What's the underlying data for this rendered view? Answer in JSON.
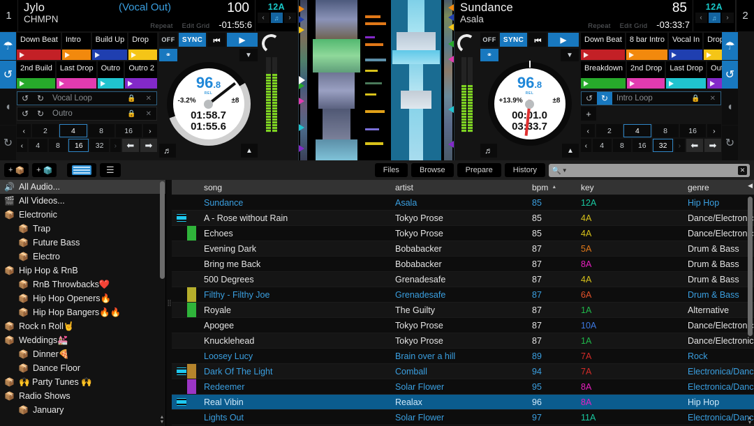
{
  "decks": {
    "left": {
      "number": "1",
      "title": "Jylo",
      "artist": "CHMPN",
      "status": "(Vocal Out)",
      "bpm": "100",
      "time_remaining": "-01:55:6",
      "repeat_label": "Repeat",
      "edit_grid_label": "Edit Grid",
      "key": "12A",
      "platter": {
        "bpm_int": "96",
        "bpm_dec": ".8",
        "rel_label": "REL",
        "pitch": "-3.2%",
        "range": "±8",
        "time_elapsed": "01:58.7",
        "time_total": "01:55.6"
      },
      "transport": {
        "off": "OFF",
        "sync": "SYNC",
        "cue": "⏮",
        "play": "▶"
      },
      "cues": [
        {
          "label": "Down Beat",
          "color": "#c32026"
        },
        {
          "label": "Intro",
          "color": "#f2890d"
        },
        {
          "label": "Build Up",
          "color": "#1f3fb0"
        },
        {
          "label": "Drop",
          "color": "#f5c517"
        },
        {
          "label": "2nd Build",
          "color": "#27a92b"
        },
        {
          "label": "Last Drop",
          "color": "#e23bb0"
        },
        {
          "label": "Outro",
          "color": "#20c4cf"
        },
        {
          "label": "Outro 2",
          "color": "#8329c9"
        }
      ],
      "loops": [
        {
          "name": "Vocal Loop",
          "active": false
        },
        {
          "name": "Outro",
          "active": false
        }
      ],
      "beat_row_1": [
        "‹",
        "2",
        "4",
        "8",
        "16",
        "›"
      ],
      "beat_row_1_selected": "4",
      "beat_row_2": [
        "‹",
        "4",
        "8",
        "16",
        "32",
        "›"
      ],
      "beat_row_2_selected": "16",
      "shift_left": "⬅",
      "shift_right": "➡"
    },
    "right": {
      "number": "2",
      "title": "Sundance",
      "artist": "Asala",
      "status": "",
      "bpm": "85",
      "time_remaining": "-03:33:7",
      "repeat_label": "Repeat",
      "edit_grid_label": "Edit Grid",
      "key": "12A",
      "platter": {
        "bpm_int": "96",
        "bpm_dec": ".8",
        "rel_label": "REL",
        "pitch": "+13.9%",
        "range": "±8",
        "time_elapsed": "00:01.0",
        "time_total": "03:33.7"
      },
      "transport": {
        "off": "OFF",
        "sync": "SYNC",
        "cue": "⏮",
        "play": "▶"
      },
      "cues": [
        {
          "label": "Down Beat",
          "color": "#c32026"
        },
        {
          "label": "8 bar Intro",
          "color": "#f2890d"
        },
        {
          "label": "Vocal In",
          "color": "#1f3fb0"
        },
        {
          "label": "Drop",
          "color": "#f5c517"
        },
        {
          "label": "Breakdown",
          "color": "#27a92b"
        },
        {
          "label": "2nd Drop",
          "color": "#e23bb0"
        },
        {
          "label": "Last Drop",
          "color": "#20c4cf"
        },
        {
          "label": "Outro",
          "color": "#8329c9"
        }
      ],
      "loops": [
        {
          "name": "Intro Loop",
          "active": true
        }
      ],
      "add_loop_label": "+",
      "beat_row_1": [
        "‹",
        "2",
        "4",
        "8",
        "16",
        "›"
      ],
      "beat_row_1_selected": "4",
      "beat_row_2": [
        "‹",
        "4",
        "8",
        "16",
        "32",
        "›"
      ],
      "beat_row_2_selected": "32",
      "shift_left": "⬅",
      "shift_right": "➡"
    }
  },
  "toolbar": {
    "add_crate_label": "+",
    "add_smart_crate_label": "+",
    "tabs": [
      "Files",
      "Browse",
      "Prepare",
      "History"
    ],
    "search_placeholder": "",
    "search_value": "",
    "clear_label": "✕"
  },
  "sidebar": {
    "items": [
      {
        "label": "All Audio...",
        "icon": "speaker-icon",
        "level": 0,
        "selected": true
      },
      {
        "label": "All Videos...",
        "icon": "film-icon",
        "level": 0,
        "selected": false
      },
      {
        "label": "Electronic",
        "icon": "crate-icon",
        "level": 0,
        "selected": false
      },
      {
        "label": "Trap",
        "icon": "crate-icon",
        "level": 1,
        "selected": false
      },
      {
        "label": "Future Bass",
        "icon": "crate-icon",
        "level": 1,
        "selected": false
      },
      {
        "label": "Electro",
        "icon": "crate-icon",
        "level": 1,
        "selected": false
      },
      {
        "label": "Hip Hop & RnB",
        "icon": "crate-icon",
        "level": 0,
        "selected": false
      },
      {
        "label": "RnB Throwbacks❤️",
        "icon": "crate-icon",
        "level": 1,
        "selected": false
      },
      {
        "label": "Hip Hop Openers🔥",
        "icon": "crate-icon",
        "level": 1,
        "selected": false
      },
      {
        "label": "Hip Hop Bangers🔥🔥",
        "icon": "crate-icon",
        "level": 1,
        "selected": false
      },
      {
        "label": "Rock n Roll🤘",
        "icon": "crate-icon",
        "level": 0,
        "selected": false
      },
      {
        "label": "Weddings💒",
        "icon": "crate-icon",
        "level": 0,
        "selected": false
      },
      {
        "label": "Dinner🍕",
        "icon": "crate-icon",
        "level": 1,
        "selected": false
      },
      {
        "label": "Dance Floor",
        "icon": "crate-icon",
        "level": 1,
        "selected": false
      },
      {
        "label": "🙌 Party Tunes 🙌",
        "icon": "crate-icon",
        "level": 0,
        "selected": false
      },
      {
        "label": "Radio Shows",
        "icon": "crate-icon",
        "level": 0,
        "selected": false
      },
      {
        "label": "January",
        "icon": "crate-icon",
        "level": 1,
        "selected": false
      }
    ]
  },
  "table": {
    "columns": [
      "song",
      "artist",
      "bpm",
      "key",
      "genre"
    ],
    "sort_column": "bpm",
    "sort_arrow": "▲",
    "rows": [
      {
        "video": false,
        "color": "",
        "song": "Sundance",
        "artist": "Asala",
        "bpm": "85",
        "key": "12A",
        "key_color": "#19c8a0",
        "genre": "Hip Hop",
        "played": true,
        "selected": false
      },
      {
        "video": true,
        "color": "",
        "song": "A - Rose without Rain",
        "artist": "Tokyo Prose",
        "bpm": "85",
        "key": "4A",
        "key_color": "#d8c21a",
        "genre": "Dance/Electronic",
        "played": false,
        "selected": false
      },
      {
        "video": false,
        "color": "#2fb33a",
        "song": "Echoes",
        "artist": "Tokyo Prose",
        "bpm": "85",
        "key": "4A",
        "key_color": "#d8c21a",
        "genre": "Dance/Electronic",
        "played": false,
        "selected": false
      },
      {
        "video": false,
        "color": "",
        "song": "Evening Dark",
        "artist": "Bobabacker",
        "bpm": "87",
        "key": "5A",
        "key_color": "#e07818",
        "genre": "Drum & Bass",
        "played": false,
        "selected": false
      },
      {
        "video": false,
        "color": "",
        "song": "Bring me Back",
        "artist": "Bobabacker",
        "bpm": "87",
        "key": "8A",
        "key_color": "#e81fc0",
        "genre": "Drum & Bass",
        "played": false,
        "selected": false
      },
      {
        "video": false,
        "color": "",
        "song": "500 Degrees",
        "artist": "Grenadesafe",
        "bpm": "87",
        "key": "4A",
        "key_color": "#d8c21a",
        "genre": "Drum & Bass",
        "played": false,
        "selected": false
      },
      {
        "video": false,
        "color": "#b5ae2c",
        "song": "Filthy - Filthy Joe",
        "artist": "Grenadesafe",
        "bpm": "87",
        "key": "6A",
        "key_color": "#e3522a",
        "genre": "Drum & Bass",
        "played": true,
        "selected": false
      },
      {
        "video": false,
        "color": "#2fb33a",
        "song": "Royale",
        "artist": "The Guilty",
        "bpm": "87",
        "key": "1A",
        "key_color": "#1fb84a",
        "genre": "Alternative",
        "played": false,
        "selected": false
      },
      {
        "video": false,
        "color": "",
        "song": "Apogee",
        "artist": "Tokyo Prose",
        "bpm": "87",
        "key": "10A",
        "key_color": "#3c78e0",
        "genre": "Dance/Electronic",
        "played": false,
        "selected": false
      },
      {
        "video": false,
        "color": "",
        "song": "Knucklehead",
        "artist": "Tokyo Prose",
        "bpm": "87",
        "key": "1A",
        "key_color": "#1fb84a",
        "genre": "Dance/Electronic",
        "played": false,
        "selected": false
      },
      {
        "video": false,
        "color": "",
        "song": "Loosey Lucy",
        "artist": "Brain over a hill",
        "bpm": "89",
        "key": "7A",
        "key_color": "#d42b28",
        "genre": "Rock",
        "played": true,
        "selected": false
      },
      {
        "video": true,
        "color": "#b5842c",
        "song": "Dark Of The Light",
        "artist": "Comball",
        "bpm": "94",
        "key": "7A",
        "key_color": "#d42b28",
        "genre": "Electronica/Dance",
        "played": true,
        "selected": false
      },
      {
        "video": false,
        "color": "#9b35c4",
        "song": "Redeemer",
        "artist": "Solar Flower",
        "bpm": "95",
        "key": "8A",
        "key_color": "#e81fc0",
        "genre": "Electronica/Dance",
        "played": true,
        "selected": false
      },
      {
        "video": true,
        "color": "",
        "song": "Real Vibin",
        "artist": "Realax",
        "bpm": "96",
        "key": "8A",
        "key_color": "#e81fc0",
        "genre": "Hip Hop",
        "played": true,
        "selected": true
      },
      {
        "video": false,
        "color": "",
        "song": "Lights Out",
        "artist": "Solar Flower",
        "bpm": "97",
        "key": "11A",
        "key_color": "#19c8a0",
        "genre": "Electronica/Dance",
        "played": true,
        "selected": false
      }
    ]
  }
}
